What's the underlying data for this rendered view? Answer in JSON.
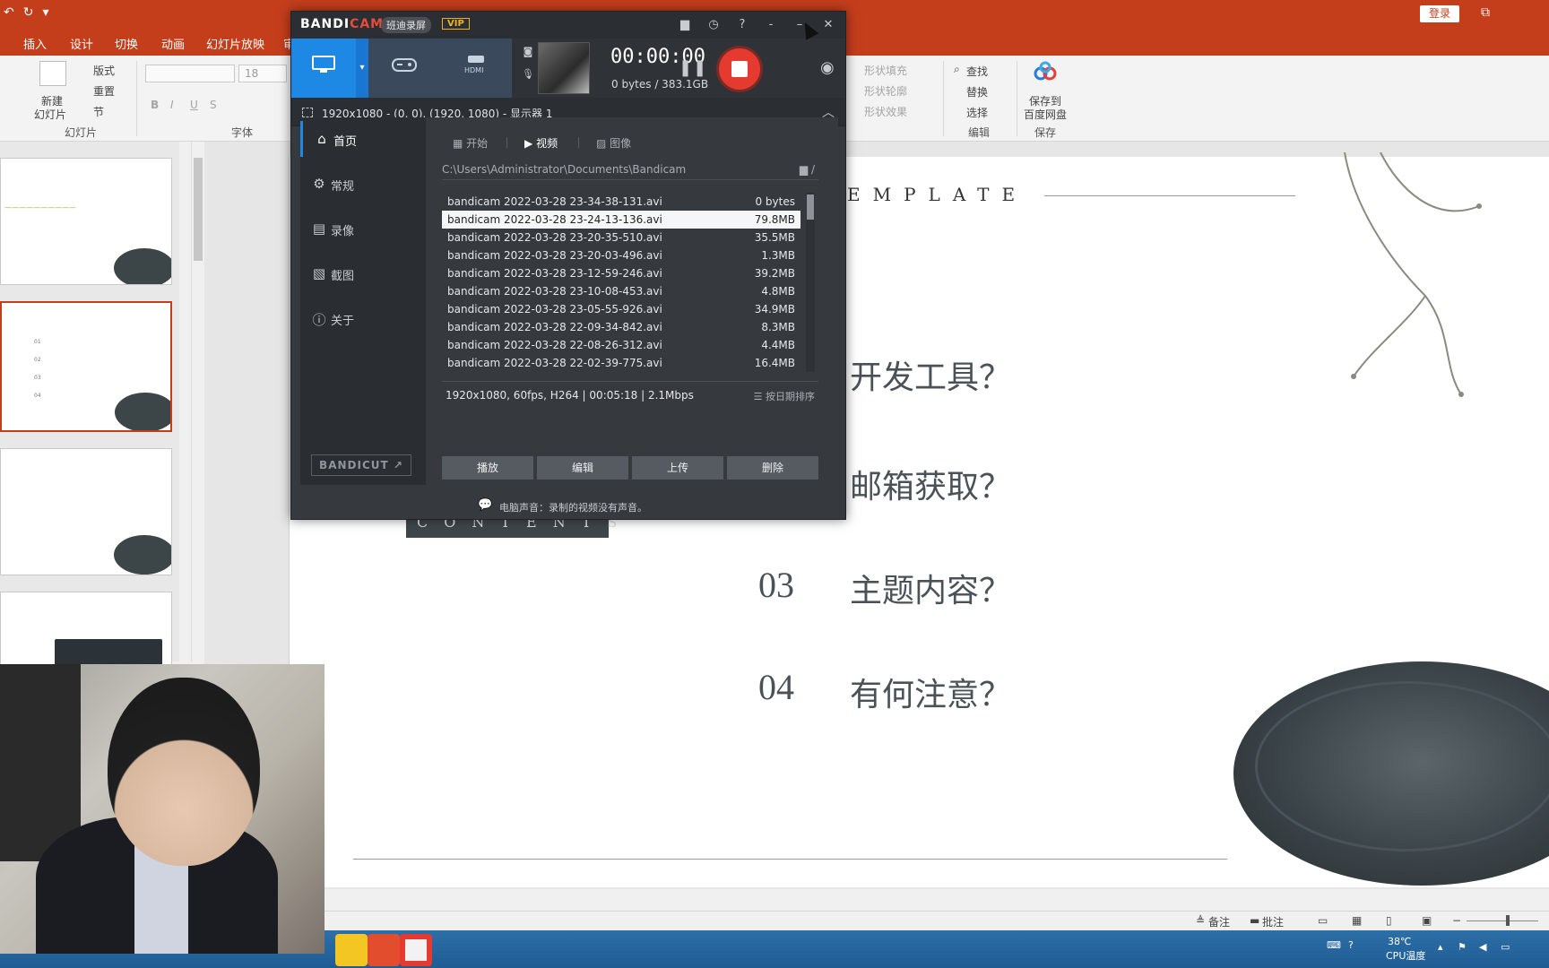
{
  "ppt": {
    "login": "登录",
    "tabs": [
      "插入",
      "设计",
      "切换",
      "动画",
      "幻灯片放映",
      "审"
    ],
    "ribbon": {
      "layout": "版式",
      "reset": "重置",
      "section": "节",
      "new_slide_1": "新建",
      "new_slide_2": "幻灯片",
      "slides_group": "幻灯片",
      "font_group": "字体",
      "font_size": "18",
      "fill": "形状填充",
      "outline": "形状轮廓",
      "effect": "形状效果",
      "find": "查找",
      "replace": "替换",
      "select": "选择",
      "edit_group": "编辑",
      "save_cloud_1": "保存到",
      "save_cloud_2": "百度网盘",
      "save_group": "保存"
    },
    "slide": {
      "template_word": "EMPLATE",
      "contents_word": "CONTENTS",
      "items": [
        {
          "num": "",
          "text": "开发工具？"
        },
        {
          "num": "",
          "text": "邮箱获取？"
        },
        {
          "num": "03",
          "text": "主题内容？"
        },
        {
          "num": "04",
          "text": "有何注意？"
        }
      ]
    },
    "status": {
      "notes": "备注",
      "comments": "批注"
    },
    "tray": {
      "temp": "38℃",
      "cpu": "CPU温度"
    }
  },
  "bandicam": {
    "logo_a": "BANDI",
    "logo_b": "CAM",
    "cn_name": "班迪录屏",
    "vip": "VIP",
    "timer": "00:00:00",
    "size_info": "0 bytes / 383.1GB",
    "target": "1920x1080 - (0, 0), (1920, 1080) - 显示器 1",
    "sidebar": [
      "首页",
      "常规",
      "录像",
      "截图",
      "关于"
    ],
    "bandicut": "BANDICUT",
    "subtabs": [
      "开始",
      "视频",
      "图像"
    ],
    "path": "C:\\Users\\Administrator\\Documents\\Bandicam",
    "files": [
      {
        "name": "bandicam 2022-03-28 23-34-38-131.avi",
        "size": "0 bytes"
      },
      {
        "name": "bandicam 2022-03-28 23-24-13-136.avi",
        "size": "79.8MB"
      },
      {
        "name": "bandicam 2022-03-28 23-20-35-510.avi",
        "size": "35.5MB"
      },
      {
        "name": "bandicam 2022-03-28 23-20-03-496.avi",
        "size": "1.3MB"
      },
      {
        "name": "bandicam 2022-03-28 23-12-59-246.avi",
        "size": "39.2MB"
      },
      {
        "name": "bandicam 2022-03-28 23-10-08-453.avi",
        "size": "4.8MB"
      },
      {
        "name": "bandicam 2022-03-28 23-05-55-926.avi",
        "size": "34.9MB"
      },
      {
        "name": "bandicam 2022-03-28 22-09-34-842.avi",
        "size": "8.3MB"
      },
      {
        "name": "bandicam 2022-03-28 22-08-26-312.avi",
        "size": "4.4MB"
      },
      {
        "name": "bandicam 2022-03-28 22-02-39-775.avi",
        "size": "16.4MB"
      }
    ],
    "file_info": "1920x1080, 60fps, H264 | 00:05:18 | 2.1Mbps",
    "sort_label": "按日期排序",
    "actions": [
      "播放",
      "编辑",
      "上传",
      "删除"
    ],
    "footer": "电脑声音：录制的视频没有声音。",
    "colors": {
      "accent": "#1e88e5",
      "record": "#e53a2f",
      "vip": "#f0b323"
    }
  }
}
